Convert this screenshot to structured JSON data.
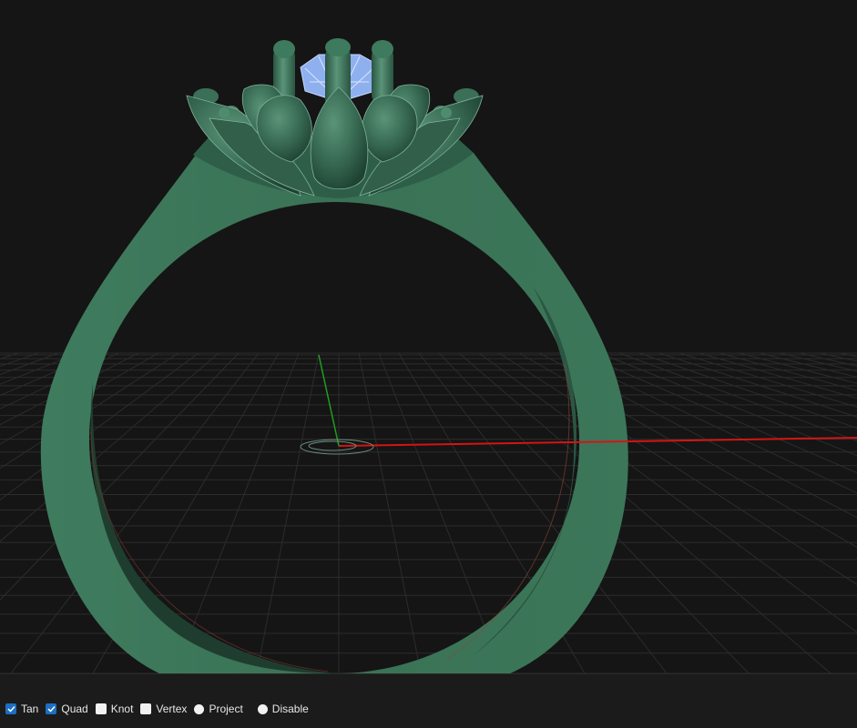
{
  "viewport": {
    "background": "#151515",
    "grid_color": "#2c2c2c",
    "axis_x_color": "#d41414",
    "axis_y_color": "#1ea01e",
    "model": {
      "band_color": "#3b7458",
      "band_edge_color": "#2a5a44",
      "head_color": "#3a6b54",
      "stone_color": "#8fb0ef"
    }
  },
  "statusbar": {
    "osnaps": [
      {
        "label": "Tan",
        "control": "checkbox",
        "checked": true
      },
      {
        "label": "Quad",
        "control": "checkbox",
        "checked": true
      },
      {
        "label": "Knot",
        "control": "checkbox",
        "checked": false
      },
      {
        "label": "Vertex",
        "control": "checkbox",
        "checked": false
      },
      {
        "label": "Project",
        "control": "radio",
        "checked": false
      },
      {
        "label": "Disable",
        "control": "radio",
        "checked": false
      }
    ]
  }
}
